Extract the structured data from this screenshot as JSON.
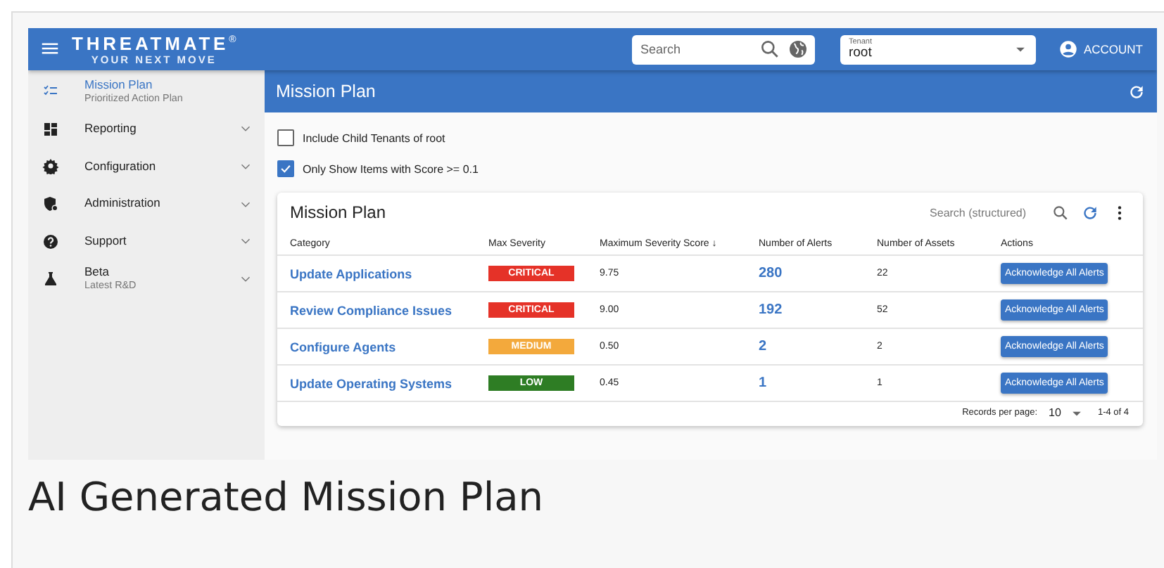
{
  "app_bar": {
    "logo": "THREATMATE$^{®}$",
    "tagline": "YOUR NEXT MOVE",
    "search": {
      "placeholder": "Search"
    },
    "tenant": {
      "label": "Tenant",
      "value": "root"
    },
    "account": "ACCOUNT"
  },
  "sidebar": {
    "items": [
      {
        "label": "Mission Plan",
        "sublabel": "Prioritized Action Plan",
        "selected": true
      },
      {
        "label": "Reporting",
        "selected": false
      },
      {
        "label": "Configuration",
        "selected": false
      },
      {
        "label": "Administration",
        "selected": false
      },
      {
        "label": "Support",
        "selected": false
      },
      {
        "label": "Beta",
        "sublabel": "Latest R&D",
        "selected": false
      }
    ]
  },
  "page_title": "Mission Plan",
  "filters": [
    {
      "label": "Include Child Tenants of root",
      "checked": false
    },
    {
      "label": "Only Show Items with Score >= 0.1",
      "checked": true
    }
  ],
  "table": {
    "title": "Mission Plan",
    "search_placeholder": "Search (structured)",
    "columns": [
      "Category",
      "Max Severity",
      "Maximum Severity Score ↓",
      "Number of Alerts",
      "Number of Assets",
      "Actions"
    ],
    "rows": [
      {
        "category": "Update Applications",
        "severity": "CRITICAL",
        "color": "#e53228",
        "score": "9.75",
        "alerts": "280",
        "assets": "22",
        "action": "Acknowledge All Alerts"
      },
      {
        "category": "Review Compliance Issues",
        "severity": "CRITICAL",
        "color": "#e53228",
        "score": "9.00",
        "alerts": "192",
        "assets": "52",
        "action": "Acknowledge All Alerts"
      },
      {
        "category": "Configure Agents",
        "severity": "MEDIUM",
        "color": "#f3a93c",
        "score": "0.50",
        "alerts": "2",
        "assets": "2",
        "action": "Acknowledge All Alerts"
      },
      {
        "category": "Update Operating Systems",
        "severity": "LOW",
        "color": "#2e7d24",
        "score": "0.45",
        "alerts": "1",
        "assets": "1",
        "action": "Acknowledge All Alerts"
      }
    ],
    "pagination": {
      "label": "Records per page:",
      "per_page": "10",
      "range": "1-4 of 4"
    }
  },
  "caption": "AI Generated Mission Plan"
}
